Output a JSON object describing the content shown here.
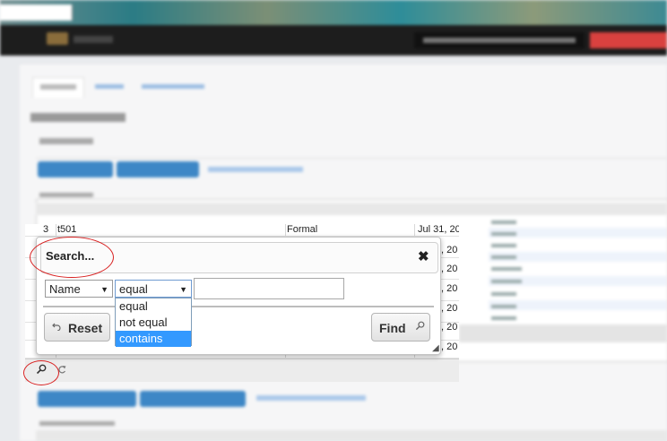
{
  "grid": {
    "rows": [
      {
        "num": "3",
        "name": "t501",
        "type": "Formal",
        "date": "Jul 31, 20"
      },
      {
        "num": "",
        "name": "",
        "type": "",
        "date": ", 20"
      },
      {
        "num": "",
        "name": "",
        "type": "",
        "date": ", 20"
      },
      {
        "num": "",
        "name": "",
        "type": "",
        "date": ", 20"
      },
      {
        "num": "",
        "name": "",
        "type": "",
        "date": ", 20"
      },
      {
        "num": "",
        "name": "",
        "type": "",
        "date": ", 20"
      },
      {
        "num": "",
        "name": "",
        "type": "",
        "date": ", 20"
      },
      {
        "num": "",
        "name": "",
        "type": "",
        "date": "7, 20"
      }
    ]
  },
  "search_dialog": {
    "title": "Search...",
    "close_glyph": "✖",
    "field_select": {
      "value": "Name",
      "arrow": "▼"
    },
    "operator_select": {
      "value": "equal",
      "arrow": "▼",
      "options": [
        "equal",
        "not equal",
        "contains"
      ],
      "highlighted": "contains"
    },
    "value_input": "",
    "reset_label": "Reset",
    "reset_icon": "undo-icon",
    "find_label": "Find",
    "find_icon": "search-icon",
    "resize_glyph": "◢"
  },
  "pager": {
    "search_icon": "search-icon",
    "refresh_icon": "refresh-icon"
  },
  "colors": {
    "highlight": "#3399ff",
    "annotation_red": "#d82020",
    "nav_dark": "#1d1d1d",
    "accent_red": "#d9413f",
    "button_blue": "#3d87c6"
  }
}
